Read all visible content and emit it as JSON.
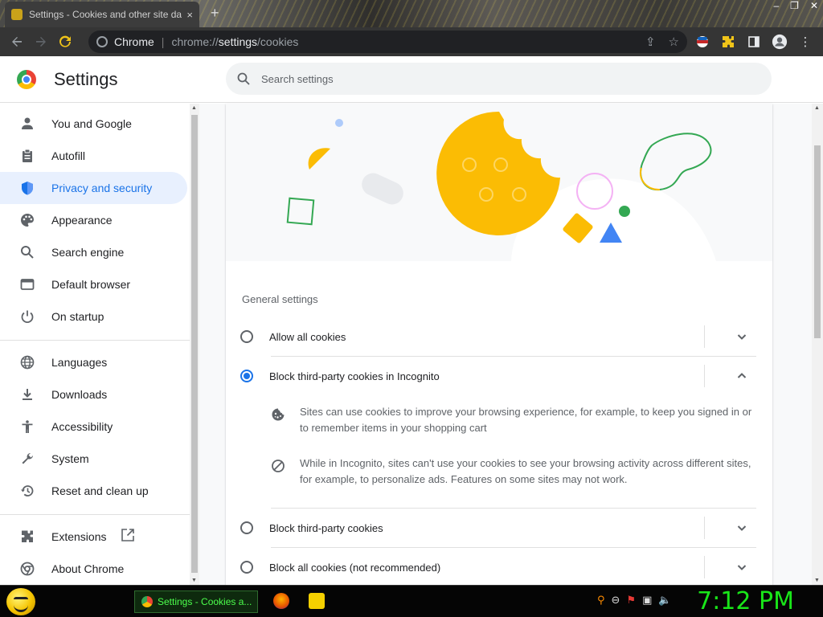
{
  "browser": {
    "tab_title": "Settings - Cookies and other site data",
    "tab_close": "×",
    "new_tab": "+",
    "window_controls": [
      "–",
      "❐",
      "✕"
    ],
    "omnibox_chrome_label": "Chrome",
    "omnibox_sep": "|",
    "url_prefix": "chrome://",
    "url_bold": "settings",
    "url_suffix": "/cookies"
  },
  "header": {
    "title": "Settings",
    "search_placeholder": "Search settings"
  },
  "sidebar": {
    "items": [
      {
        "label": "You and Google",
        "icon": "person-icon"
      },
      {
        "label": "Autofill",
        "icon": "clipboard-icon"
      },
      {
        "label": "Privacy and security",
        "icon": "shield-icon"
      },
      {
        "label": "Appearance",
        "icon": "palette-icon"
      },
      {
        "label": "Search engine",
        "icon": "search-icon"
      },
      {
        "label": "Default browser",
        "icon": "browser-window-icon"
      },
      {
        "label": "On startup",
        "icon": "power-icon"
      },
      {
        "label": "Languages",
        "icon": "globe-icon"
      },
      {
        "label": "Downloads",
        "icon": "download-icon"
      },
      {
        "label": "Accessibility",
        "icon": "accessibility-icon"
      },
      {
        "label": "System",
        "icon": "wrench-icon"
      },
      {
        "label": "Reset and clean up",
        "icon": "history-icon"
      },
      {
        "label": "Extensions",
        "icon": "puzzle-icon"
      },
      {
        "label": "About Chrome",
        "icon": "chrome-icon"
      }
    ],
    "active": "Privacy and security"
  },
  "main": {
    "section_title": "General settings",
    "options": [
      {
        "label": "Allow all cookies",
        "selected": false,
        "expanded": false
      },
      {
        "label": "Block third-party cookies in Incognito",
        "selected": true,
        "expanded": true
      },
      {
        "label": "Block third-party cookies",
        "selected": false,
        "expanded": false
      },
      {
        "label": "Block all cookies (not recommended)",
        "selected": false,
        "expanded": false
      }
    ],
    "details": [
      {
        "icon": "cookie-icon",
        "text": "Sites can use cookies to improve your browsing experience, for example, to keep you signed in or to remember items in your shopping cart"
      },
      {
        "icon": "block-icon",
        "text": "While in Incognito, sites can't use your cookies to see your browsing activity across different sites, for example, to personalize ads. Features on some sites may not work."
      }
    ]
  },
  "taskbar": {
    "task_label": "Settings - Cookies a...",
    "clock": "7:12 PM"
  },
  "colors": {
    "accent": "#1a73e8",
    "active_bg": "#e8f0fe",
    "cookie_yellow": "#fbbc04",
    "clock_green": "#19e619"
  }
}
